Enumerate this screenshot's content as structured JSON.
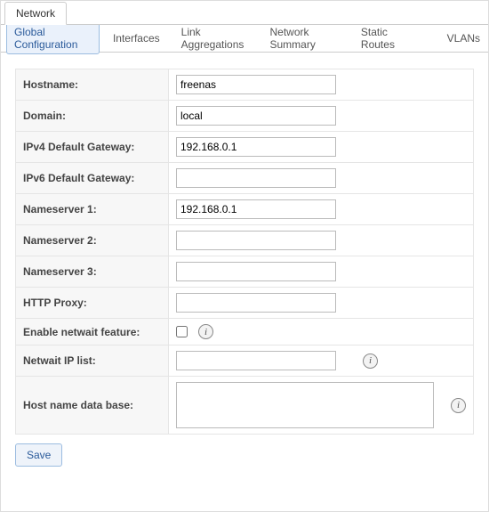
{
  "primary_tab": {
    "label": "Network"
  },
  "tabs": {
    "global": "Global Configuration",
    "interfaces": "Interfaces",
    "linkagg": "Link Aggregations",
    "summary": "Network Summary",
    "routes": "Static Routes",
    "vlans": "VLANs"
  },
  "form": {
    "hostname": {
      "label": "Hostname:",
      "value": "freenas"
    },
    "domain": {
      "label": "Domain:",
      "value": "local"
    },
    "ipv4gw": {
      "label": "IPv4 Default Gateway:",
      "value": "192.168.0.1"
    },
    "ipv6gw": {
      "label": "IPv6 Default Gateway:",
      "value": ""
    },
    "ns1": {
      "label": "Nameserver 1:",
      "value": "192.168.0.1"
    },
    "ns2": {
      "label": "Nameserver 2:",
      "value": ""
    },
    "ns3": {
      "label": "Nameserver 3:",
      "value": ""
    },
    "httpproxy": {
      "label": "HTTP Proxy:",
      "value": ""
    },
    "netwait": {
      "label": "Enable netwait feature:",
      "checked": false
    },
    "netwaitlist": {
      "label": "Netwait IP list:",
      "value": ""
    },
    "hostdb": {
      "label": "Host name data base:",
      "value": ""
    }
  },
  "buttons": {
    "save": "Save"
  },
  "icons": {
    "info_glyph": "i"
  }
}
